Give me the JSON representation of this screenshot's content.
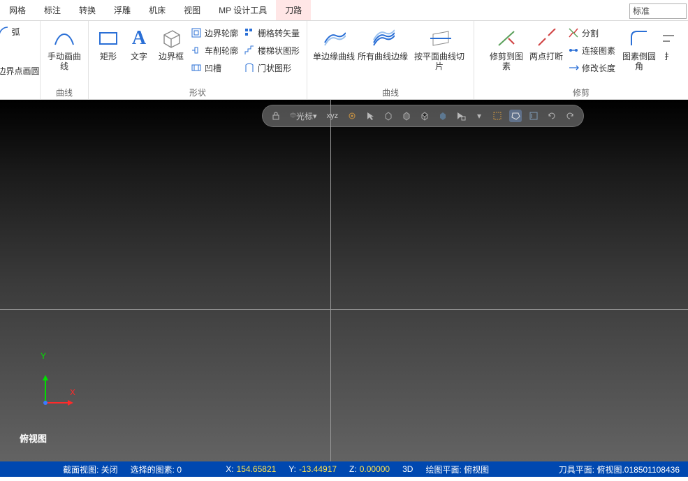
{
  "tabs": {
    "items": [
      "网格",
      "标注",
      "转换",
      "浮雕",
      "机床",
      "视图",
      "MP 设计工具",
      "刀路"
    ],
    "active": 7
  },
  "search": {
    "value": "标准"
  },
  "ribbon": {
    "groups": [
      {
        "label": "",
        "big": [
          {
            "label": "弧"
          },
          {
            "label": "边界点画圆"
          }
        ]
      },
      {
        "label": "曲线",
        "big": [
          {
            "label": "手动画曲线"
          }
        ]
      },
      {
        "label": "形状",
        "big": [
          {
            "label": "矩形"
          },
          {
            "label": "文字"
          },
          {
            "label": "边界框"
          }
        ],
        "mini1": [
          "边界轮廓",
          "车削轮廓",
          "凹槽"
        ],
        "mini2": [
          "栅格转矢量",
          "楼梯状图形",
          "门状图形"
        ]
      },
      {
        "label": "曲线",
        "big": [
          {
            "label": "单边缘曲线"
          },
          {
            "label": "所有曲线边缘"
          },
          {
            "label": "按平面曲线切片"
          }
        ]
      },
      {
        "label": "修剪",
        "big": [
          {
            "label": "修剪到图素"
          },
          {
            "label": "两点打断"
          }
        ],
        "mini": [
          "分割",
          "连接图素",
          "修改长度"
        ],
        "big2": [
          {
            "label": "图素倒圆角"
          }
        ]
      }
    ]
  },
  "float": {
    "cursor": "光标",
    "xyz": "xyz"
  },
  "axis": {
    "x": "X",
    "y": "Y"
  },
  "viewport": {
    "name": "俯视图"
  },
  "status": {
    "section_view": "截面视图: 关闭",
    "selected": "选择的图素: 0",
    "x": "154.65821",
    "y": "-13.44917",
    "z": "0.00000",
    "mode": "3D",
    "plane": "绘图平面: 俯视图",
    "right": "刀具平面: 俯视图.018501108436"
  }
}
